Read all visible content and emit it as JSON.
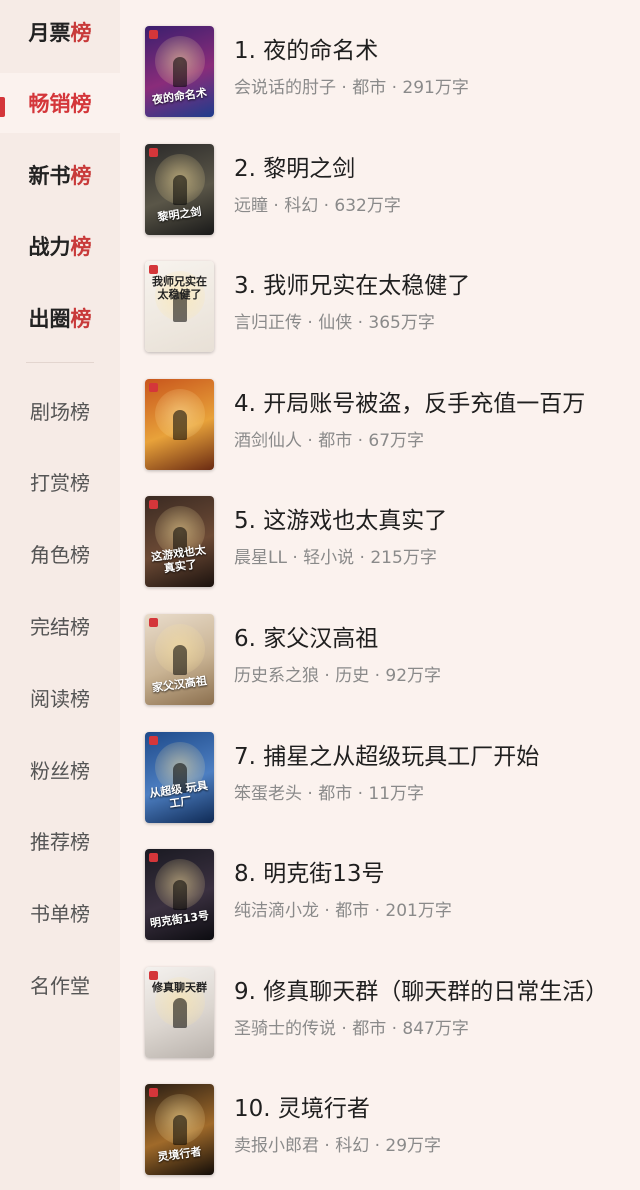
{
  "sidebar": {
    "major": [
      {
        "main": "月票",
        "accent": "榜"
      },
      {
        "main": "畅销",
        "accent": "榜"
      },
      {
        "main": "新书",
        "accent": "榜"
      },
      {
        "main": "战力",
        "accent": "榜"
      },
      {
        "main": "出圈",
        "accent": "榜"
      }
    ],
    "active_index": 1,
    "minor": [
      "剧场榜",
      "打赏榜",
      "角色榜",
      "完结榜",
      "阅读榜",
      "粉丝榜",
      "推荐榜",
      "书单榜",
      "名作堂"
    ]
  },
  "books": [
    {
      "rank": "1.",
      "title": "夜的命名术",
      "meta": "会说话的肘子 · 都市 · 291万字",
      "cover_text": "夜的命名术",
      "cover_colors": [
        "#3a1f6e",
        "#8a2c7a",
        "#1e3c8c"
      ]
    },
    {
      "rank": "2.",
      "title": "黎明之剑",
      "meta": "远瞳 · 科幻 · 632万字",
      "cover_text": "黎明之剑",
      "cover_colors": [
        "#2b2a2a",
        "#5a5648",
        "#191919"
      ]
    },
    {
      "rank": "3.",
      "title": "我师兄实在太稳健了",
      "meta": "言归正传 · 仙侠 · 365万字",
      "cover_text": "我师兄实在 太稳健了",
      "cover_colors": [
        "#f7f3ee",
        "#efe9e1",
        "#e8e0d6"
      ]
    },
    {
      "rank": "4.",
      "title": "开局账号被盗，反手充值一百万",
      "meta": "酒剑仙人 · 都市 · 67万字",
      "cover_text": "",
      "cover_colors": [
        "#c8551c",
        "#e8a23a",
        "#6a2a12"
      ]
    },
    {
      "rank": "5.",
      "title": "这游戏也太真实了",
      "meta": "晨星LL · 轻小说 · 215万字",
      "cover_text": "这游戏也太真实了",
      "cover_colors": [
        "#3a2a22",
        "#6c4a35",
        "#1b120e"
      ]
    },
    {
      "rank": "6.",
      "title": "家父汉高祖",
      "meta": "历史系之狼 · 历史 · 92万字",
      "cover_text": "家父汉高祖",
      "cover_colors": [
        "#e9dccb",
        "#c9b393",
        "#8b6f4e"
      ]
    },
    {
      "rank": "7.",
      "title": "捕星之从超级玩具工厂开始",
      "meta": "笨蛋老头 · 都市 · 11万字",
      "cover_text": "从超级 玩具工厂",
      "cover_colors": [
        "#1e4a8a",
        "#4d7fc2",
        "#0f2a55"
      ]
    },
    {
      "rank": "8.",
      "title": "明克街13号",
      "meta": "纯洁滴小龙 · 都市 · 201万字",
      "cover_text": "明克街13号",
      "cover_colors": [
        "#1a1a22",
        "#3a3040",
        "#0c0c10"
      ]
    },
    {
      "rank": "9.",
      "title": "修真聊天群（聊天群的日常生活）",
      "meta": "圣骑士的传说 · 都市 · 847万字",
      "cover_text": "修真聊天群",
      "cover_colors": [
        "#f4f1ee",
        "#dcd6d0",
        "#b9b2ac"
      ]
    },
    {
      "rank": "10.",
      "title": "灵境行者",
      "meta": "卖报小郎君 · 科幻 · 29万字",
      "cover_text": "灵境行者",
      "cover_colors": [
        "#2a1e14",
        "#a06a2a",
        "#120c08"
      ]
    }
  ],
  "colors": {
    "accent": "#d4363a",
    "sidebar_bg": "#f6ebe6",
    "page_bg": "#fbf2ee"
  }
}
